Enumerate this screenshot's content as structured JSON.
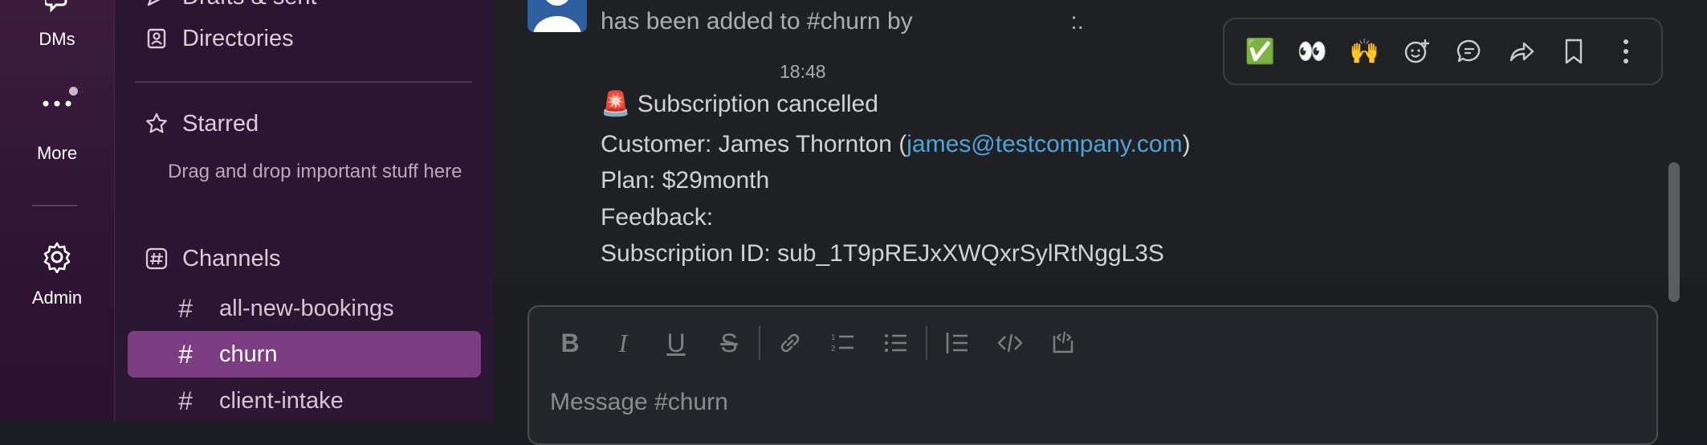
{
  "rail": {
    "dms_label": "DMs",
    "more_label": "More",
    "admin_label": "Admin"
  },
  "sidebar": {
    "drafts_label": "Drafts & sent",
    "directories_label": "Directories",
    "starred_label": "Starred",
    "starred_hint": "Drag and drop important stuff here",
    "channels_label": "Channels",
    "channels": [
      "all-new-bookings",
      "churn",
      "client-intake"
    ],
    "active_channel": "churn"
  },
  "message": {
    "join_text": "has been added to #churn by",
    "join_suffix": ":.",
    "time": "18:48",
    "emoji": "🚨",
    "title": "Subscription cancelled",
    "customer_prefix": "Customer: James Thornton (",
    "customer_email": "james@testcompany.com",
    "customer_suffix": ")",
    "plan": "Plan: $29month",
    "feedback": "Feedback:",
    "subscription_id": "Subscription ID: sub_1T9pREJxXWQxrSylRtNggL3S"
  },
  "toolbar": {
    "reactions": [
      "✅",
      "👀",
      "🙌"
    ]
  },
  "composer": {
    "placeholder": "Message #churn"
  },
  "colors": {
    "rail_bg": "#3b1c3d",
    "sidebar_bg": "#2a1530",
    "active_channel_bg": "#7b3c82",
    "link": "#4fa3d9"
  }
}
